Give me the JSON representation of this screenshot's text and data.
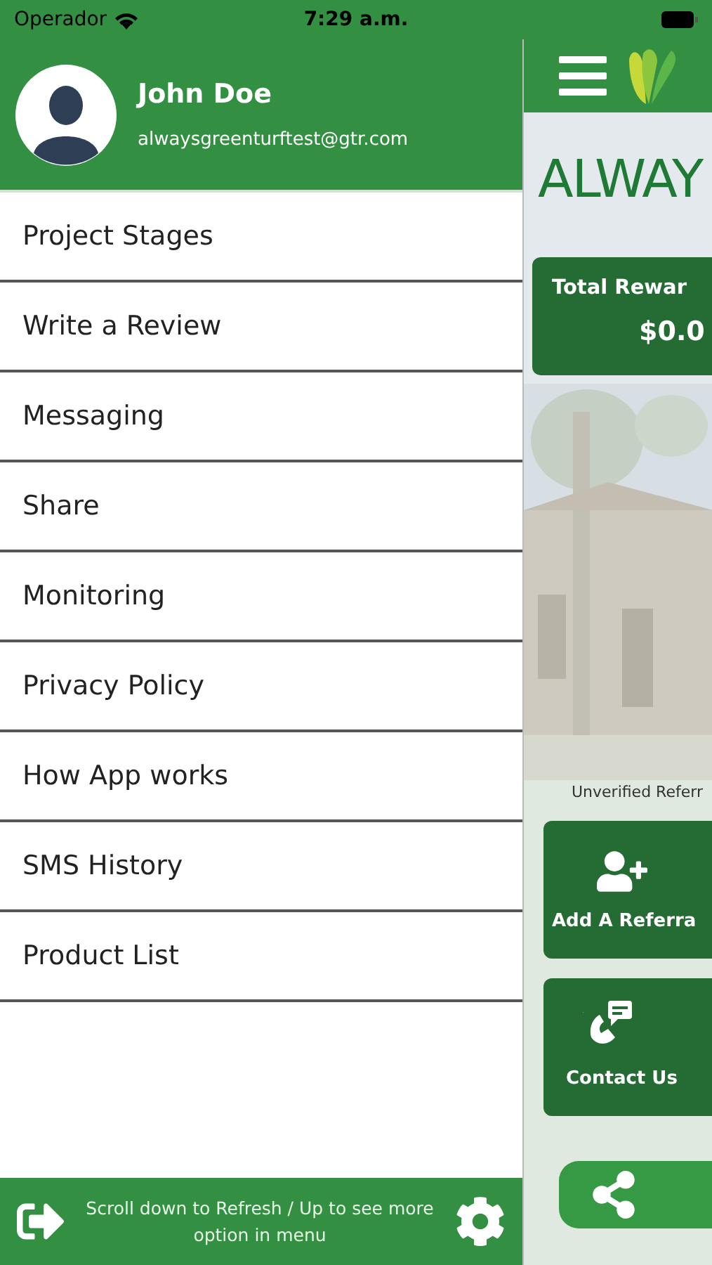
{
  "status_bar": {
    "carrier": "Operador",
    "time": "7:29 a.m."
  },
  "profile": {
    "name": "John Doe",
    "email": "alwaysgreenturftest@gtr.com"
  },
  "menu": {
    "items": [
      {
        "label": "Project Stages"
      },
      {
        "label": "Write a Review"
      },
      {
        "label": "Messaging"
      },
      {
        "label": "Share"
      },
      {
        "label": "Monitoring"
      },
      {
        "label": "Privacy Policy"
      },
      {
        "label": "How App works"
      },
      {
        "label": "SMS History"
      },
      {
        "label": "Product List"
      }
    ]
  },
  "footer": {
    "hint": "Scroll down to Refresh / Up to see more option in menu"
  },
  "main": {
    "logo_text": "ALWAY",
    "rewards": {
      "label": "Total Rewar",
      "amount": "$0.0"
    },
    "unverified_label": "Unverified Referr",
    "actions": [
      {
        "kind": "add-referral",
        "label": "Add A Referra"
      },
      {
        "kind": "contact",
        "label": "Contact Us"
      }
    ]
  }
}
